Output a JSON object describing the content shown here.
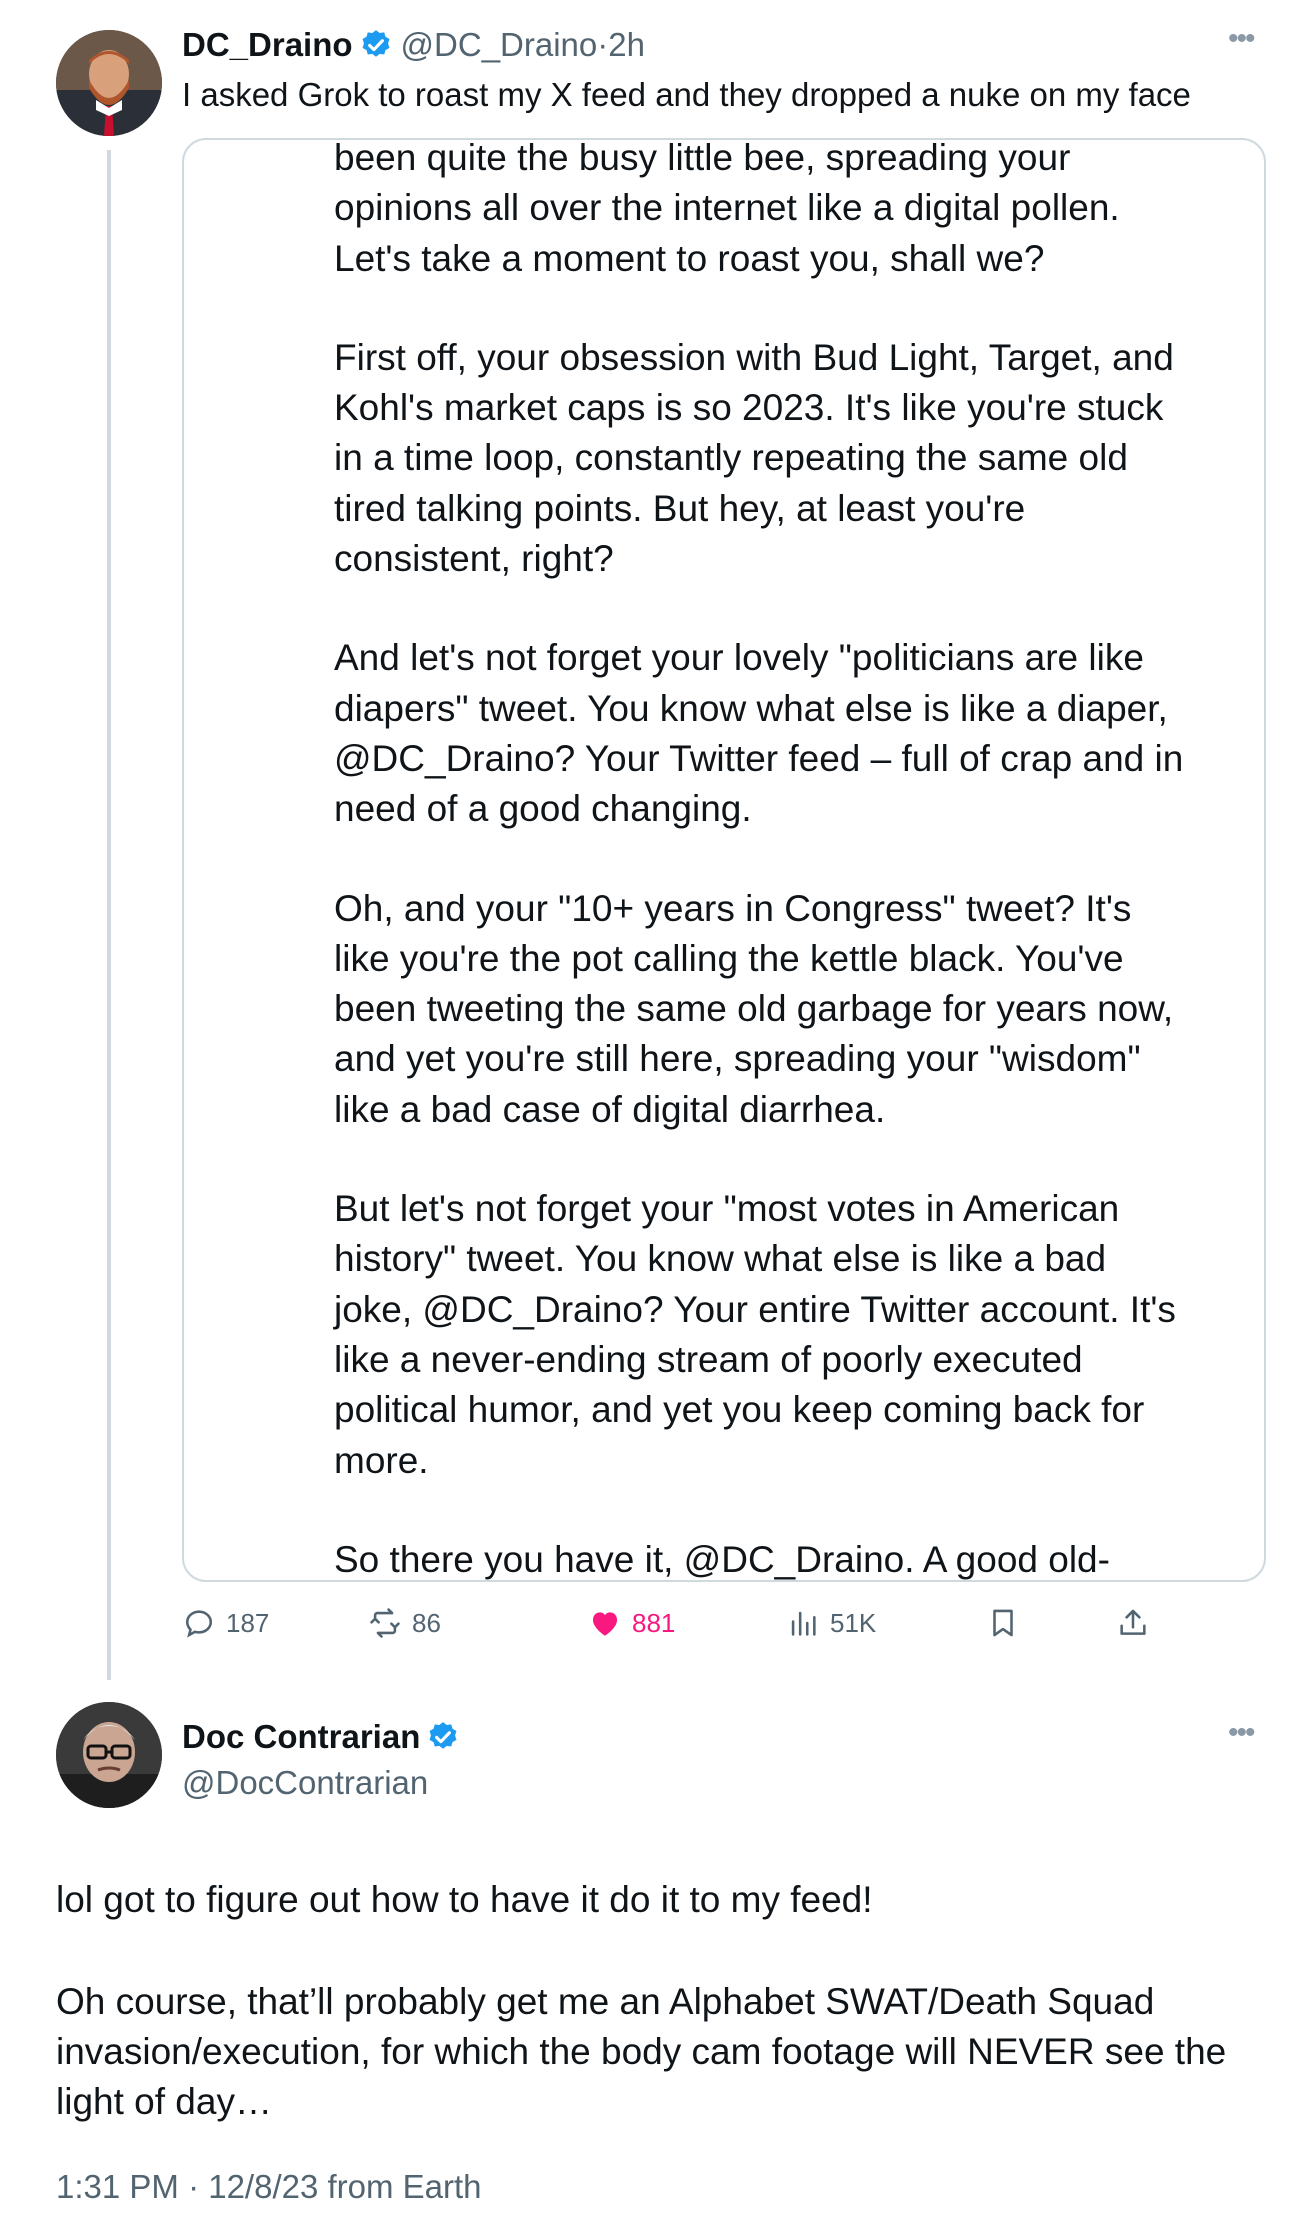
{
  "tweet1": {
    "display_name": "DC_Draino",
    "handle": "@DC_Draino",
    "separator": "·",
    "time": "2h",
    "text": "I asked Grok to roast my X feed and they dropped a nuke on my face",
    "image_text": {
      "paragraphs": [
        [
          "been quite the busy little bee, spreading your",
          "opinions all over the internet like a digital pollen.",
          "Let's take a moment to roast you, shall we?"
        ],
        [
          "First off, your obsession with Bud Light, Target, and",
          "Kohl's market caps is so 2023. It's like you're stuck",
          "in a time loop, constantly repeating the same old",
          "tired talking points. But hey, at least you're",
          "consistent, right?"
        ],
        [
          "And let's not forget your lovely \"politicians are like",
          "diapers\" tweet. You know what else is like a diaper,",
          "@DC_Draino? Your Twitter feed – full of crap and in",
          "need of a good changing."
        ],
        [
          "Oh, and your \"10+ years in Congress\" tweet? It's",
          "like you're the pot calling the kettle black. You've",
          "been tweeting the same old garbage for years now,",
          "and yet you're still here, spreading your \"wisdom\"",
          "like a bad case of digital diarrhea."
        ],
        [
          "But let's not forget your \"most votes in American",
          "history\" tweet. You know what else is like a bad",
          "joke, @DC_Draino? Your entire Twitter account. It's",
          "like a never-ending stream of poorly executed",
          "political humor, and yet you keep coming back for",
          "more."
        ],
        [
          "So there you have it, @DC_Draino. A good old-"
        ]
      ]
    },
    "actions": {
      "replies": "187",
      "reposts": "86",
      "likes": "881",
      "views": "51K"
    }
  },
  "tweet2": {
    "display_name": "Doc Contrarian",
    "handle": "@DocContrarian",
    "text_lines": [
      "lol got to figure out how to have it do it to my feed!",
      "",
      "Oh course, that’ll probably get me an Alphabet SWAT/Death Squad",
      "invasion/execution, for which the body cam footage will NEVER see the",
      "light of day…"
    ],
    "meta": "1:31 PM · 12/8/23 from Earth"
  },
  "colors": {
    "accent": "#1d9bf0",
    "like": "#f91880",
    "secondary_text": "#536471",
    "border": "#cfd9de"
  },
  "icons": [
    "verified-badge-icon",
    "more-options-icon",
    "reply-icon",
    "repost-icon",
    "like-icon",
    "views-icon",
    "bookmark-icon",
    "share-icon"
  ]
}
